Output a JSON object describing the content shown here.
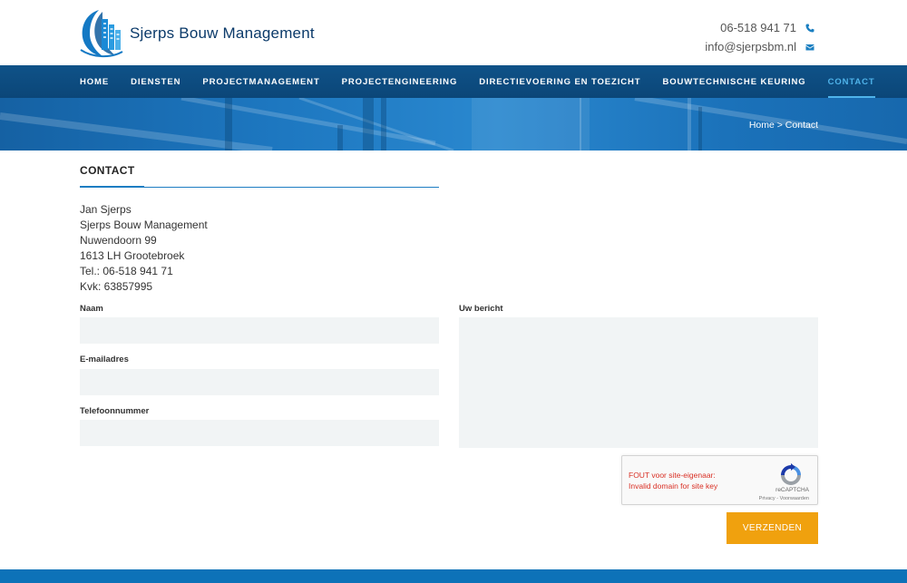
{
  "brand": {
    "name": "Sjerps Bouw Management",
    "phone": "06-518 941 71",
    "email": "info@sjerpsbm.nl"
  },
  "nav": {
    "items": [
      {
        "label": "HOME",
        "active": false
      },
      {
        "label": "DIENSTEN",
        "active": false
      },
      {
        "label": "PROJECTMANAGEMENT",
        "active": false
      },
      {
        "label": "PROJECTENGINEERING",
        "active": false
      },
      {
        "label": "DIRECTIEVOERING EN TOEZICHT",
        "active": false
      },
      {
        "label": "BOUWTECHNISCHE KEURING",
        "active": false
      },
      {
        "label": "CONTACT",
        "active": true
      }
    ]
  },
  "breadcrumb": "Home > Contact",
  "contact": {
    "title": "CONTACT",
    "address_lines": [
      "Jan Sjerps",
      "Sjerps Bouw Management",
      "Nuwendoorn 99",
      "1613 LH Grootebroek",
      "Tel.: 06-518 941 71",
      "Kvk: 63857995"
    ]
  },
  "form": {
    "name_label": "Naam",
    "name_value": "",
    "email_label": "E-mailadres",
    "email_value": "",
    "phone_label": "Telefoonnummer",
    "phone_value": "",
    "message_label": "Uw bericht",
    "message_value": "",
    "submit_label": "VERZENDEN"
  },
  "recaptcha": {
    "error_line1": "FOUT voor site-eigenaar:",
    "error_line2": "Invalid domain for site key",
    "brand": "reCAPTCHA",
    "links": "Privacy - Voorwaarden"
  },
  "icons": {
    "phone": "phone-icon",
    "email": "envelope-icon",
    "logo": "building-logo-icon",
    "recaptcha": "recaptcha-logo-icon"
  },
  "colors": {
    "nav_bg": "#0f5288",
    "nav_active": "#4fb3ea",
    "accent": "#1d7dc2",
    "submit": "#f0a10e",
    "field_bg": "#f1f4f5",
    "error": "#d93025"
  }
}
